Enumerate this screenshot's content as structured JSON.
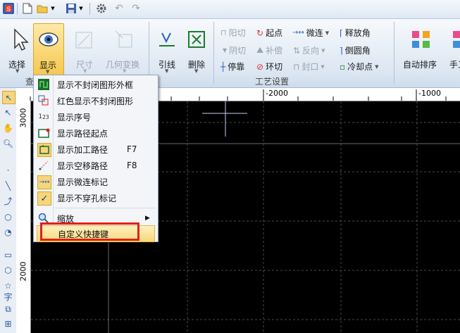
{
  "ribbon": {
    "buttons": {
      "select": "选择",
      "display": "显示",
      "size": "尺寸",
      "geometry": "几何变换",
      "leadline": "引线",
      "delete": "删除",
      "auto_sort": "自动排序",
      "manual": "手工"
    },
    "small_buttons": {
      "cut_yang": "阳切",
      "start_point": "起点",
      "micro_connect": "微连",
      "release_angle": "释放角",
      "cut_yin": "阴切",
      "compensate": "补偿",
      "reverse": "反向",
      "round_corner": "倒圆角",
      "stop": "停靠",
      "ring_cut": "环切",
      "seal": "封口",
      "cool_point": "冷却点"
    },
    "group_labels": {
      "view_partial": "查",
      "process_settings": "工艺设置"
    }
  },
  "ruler": {
    "top_labels": [
      "-2000",
      "-1000"
    ],
    "left_labels": [
      "3000",
      "2000"
    ]
  },
  "display_menu": {
    "items": [
      {
        "label": "显示不封闭图形外框",
        "shortcut": "",
        "icon": "open-shape-frame-icon"
      },
      {
        "label": "红色显示不封闭图形",
        "shortcut": "",
        "icon": "red-open-shape-icon"
      },
      {
        "label": "显示序号",
        "shortcut": "",
        "icon": "sequence-number-icon"
      },
      {
        "label": "显示路径起点",
        "shortcut": "",
        "icon": "path-start-icon"
      },
      {
        "label": "显示加工路径",
        "shortcut": "F7",
        "icon": "machining-path-icon"
      },
      {
        "label": "显示空移路径",
        "shortcut": "F8",
        "icon": "idle-move-path-icon"
      },
      {
        "label": "显示微连标记",
        "shortcut": "",
        "icon": "micro-joint-icon"
      },
      {
        "label": "显示不穿孔标记",
        "shortcut": "",
        "icon": "checkmark-icon"
      },
      {
        "label": "缩放",
        "shortcut": "",
        "icon": "zoom-icon"
      },
      {
        "label": "自定义快捷键",
        "shortcut": "",
        "icon": ""
      }
    ],
    "highlight_color": "#e0201c"
  }
}
